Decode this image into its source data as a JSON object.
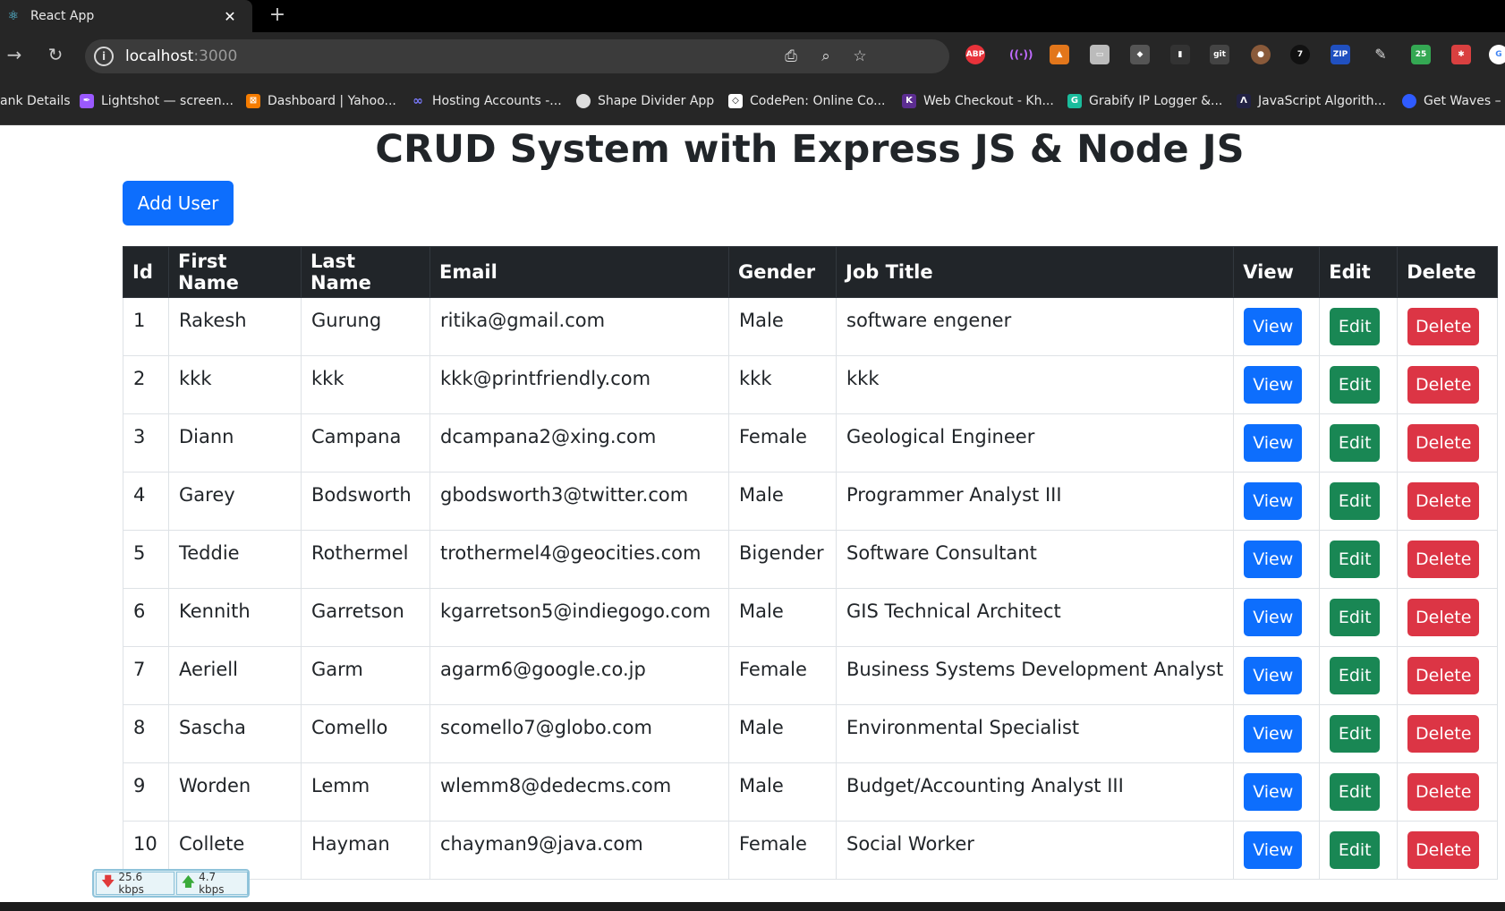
{
  "browser": {
    "tab_title": "React App",
    "tab_close": "✕",
    "new_tab": "+",
    "url_host": "localhost",
    "url_port": ":3000",
    "bookmarks": [
      {
        "label": "ank Details",
        "icon": "bookmark-icon",
        "color": "#262626"
      },
      {
        "label": "Lightshot — screen...",
        "icon": "feather-icon",
        "color": "#9b59ff"
      },
      {
        "label": "Dashboard | Yahoo...",
        "icon": "xampp-icon",
        "color": "#f57c00"
      },
      {
        "label": "Hosting Accounts -...",
        "icon": "infinity-icon",
        "color": "#7b7bff"
      },
      {
        "label": "Shape Divider App",
        "icon": "shape-icon",
        "color": "#dddddd"
      },
      {
        "label": "CodePen: Online Co...",
        "icon": "codepen-icon",
        "color": "#ffffff"
      },
      {
        "label": "Web Checkout - Kh...",
        "icon": "khalti-icon",
        "color": "#5c2d91"
      },
      {
        "label": "Grabify IP Logger &...",
        "icon": "grabify-icon",
        "color": "#1abc9c"
      },
      {
        "label": "JavaScript Algorith...",
        "icon": "code-icon",
        "color": "#222244"
      },
      {
        "label": "Get Waves – ",
        "icon": "waves-icon",
        "color": "#2f5bff"
      }
    ],
    "extension_badge": "25"
  },
  "page": {
    "title": "CRUD System with Express JS & Node JS",
    "add_button": "Add User"
  },
  "table": {
    "headers": [
      "Id",
      "First Name",
      "Last Name",
      "Email",
      "Gender",
      "Job Title",
      "View",
      "Edit",
      "Delete"
    ],
    "button_labels": {
      "view": "View",
      "edit": "Edit",
      "delete": "Delete"
    },
    "rows": [
      {
        "id": "1",
        "first": "Rakesh",
        "last": "Gurung",
        "email": "ritika@gmail.com",
        "gender": "Male",
        "job": "software engener"
      },
      {
        "id": "2",
        "first": "kkk",
        "last": "kkk",
        "email": "kkk@printfriendly.com",
        "gender": "kkk",
        "job": "kkk"
      },
      {
        "id": "3",
        "first": "Diann",
        "last": "Campana",
        "email": "dcampana2@xing.com",
        "gender": "Female",
        "job": "Geological Engineer"
      },
      {
        "id": "4",
        "first": "Garey",
        "last": "Bodsworth",
        "email": "gbodsworth3@twitter.com",
        "gender": "Male",
        "job": "Programmer Analyst III"
      },
      {
        "id": "5",
        "first": "Teddie",
        "last": "Rothermel",
        "email": "trothermel4@geocities.com",
        "gender": "Bigender",
        "job": "Software Consultant"
      },
      {
        "id": "6",
        "first": "Kennith",
        "last": "Garretson",
        "email": "kgarretson5@indiegogo.com",
        "gender": "Male",
        "job": "GIS Technical Architect"
      },
      {
        "id": "7",
        "first": "Aeriell",
        "last": "Garm",
        "email": "agarm6@google.co.jp",
        "gender": "Female",
        "job": "Business Systems Development Analyst"
      },
      {
        "id": "8",
        "first": "Sascha",
        "last": "Comello",
        "email": "scomello7@globo.com",
        "gender": "Male",
        "job": "Environmental Specialist"
      },
      {
        "id": "9",
        "first": "Worden",
        "last": "Lemm",
        "email": "wlemm8@dedecms.com",
        "gender": "Male",
        "job": "Budget/Accounting Analyst III"
      },
      {
        "id": "10",
        "first": "Collete",
        "last": "Hayman",
        "email": "chayman9@java.com",
        "gender": "Female",
        "job": "Social Worker"
      }
    ]
  },
  "network_monitor": {
    "download": "25.6 kbps",
    "upload": "4.7 kbps"
  }
}
